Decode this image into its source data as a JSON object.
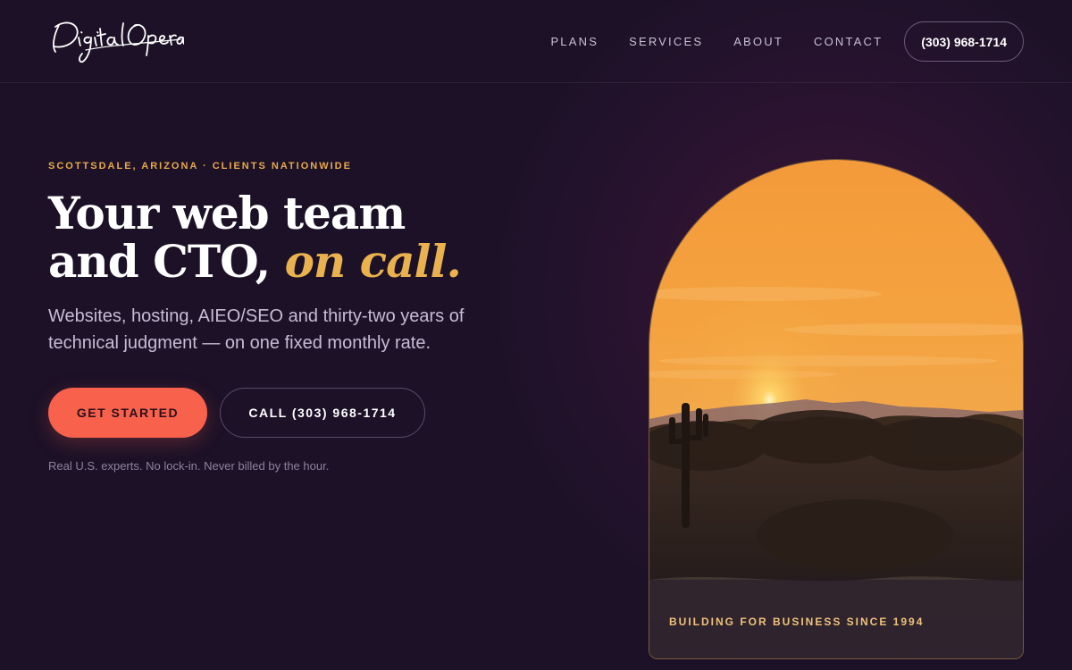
{
  "brand": {
    "logo_text": "Digital Opera"
  },
  "nav": {
    "items": [
      {
        "label": "PLANS"
      },
      {
        "label": "SERVICES"
      },
      {
        "label": "ABOUT"
      },
      {
        "label": "CONTACT"
      }
    ],
    "phone": "(303) 968-1714"
  },
  "hero": {
    "eyebrow": "SCOTTSDALE, ARIZONA · CLIENTS NATIONWIDE",
    "headline_line1": "Your web team",
    "headline_line2": "and CTO, ",
    "headline_accent": "on call.",
    "subtext": "Websites, hosting, AIEO/SEO and thirty-two years of technical judgment — on one fixed monthly rate.",
    "primary_cta": "GET STARTED",
    "secondary_cta": "CALL (303) 968-1714",
    "reassurance": "Real U.S. experts. No lock-in. Never billed by the hour."
  },
  "image": {
    "caption": "BUILDING FOR BUSINESS SINCE 1994"
  },
  "colors": {
    "background": "#1c1127",
    "accent_gold": "#eab24e",
    "accent_coral": "#f8614b",
    "text_muted": "#c8bcd4"
  }
}
